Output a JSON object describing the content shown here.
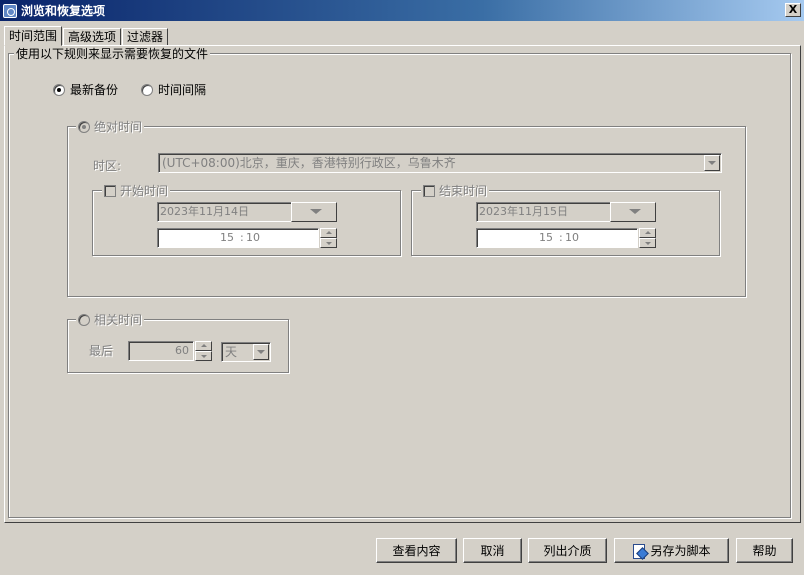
{
  "window": {
    "title": "浏览和恢复选项",
    "close_label": "X"
  },
  "tabs": [
    {
      "label": "时间范围",
      "active": true
    },
    {
      "label": "高级选项",
      "active": false
    },
    {
      "label": "过滤器",
      "active": false
    }
  ],
  "rules_group": {
    "label": "使用以下规则来显示需要恢复的文件"
  },
  "mode": {
    "latest_backup": {
      "label": "最新备份",
      "checked": true
    },
    "time_interval": {
      "label": "时间间隔",
      "checked": false
    }
  },
  "absolute_time": {
    "label": "绝对时间",
    "timezone_label": "时区:",
    "timezone_value": "(UTC+08:00)北京，重庆，香港特别行政区，乌鲁木齐",
    "start": {
      "label": "开始时间",
      "date": "2023年11月14日",
      "hour": "15",
      "separator": ":",
      "minute": "10"
    },
    "end": {
      "label": "结束时间",
      "date": "2023年11月15日",
      "hour": "15",
      "separator": ":",
      "minute": "10"
    }
  },
  "relative_time": {
    "label": "相关时间",
    "last_label": "最后",
    "value": "60",
    "unit": "天"
  },
  "buttons": {
    "view_content": "查看内容",
    "cancel": "取消",
    "list_media": "列出介质",
    "save_as_script": "另存为脚本",
    "help": "帮助"
  }
}
